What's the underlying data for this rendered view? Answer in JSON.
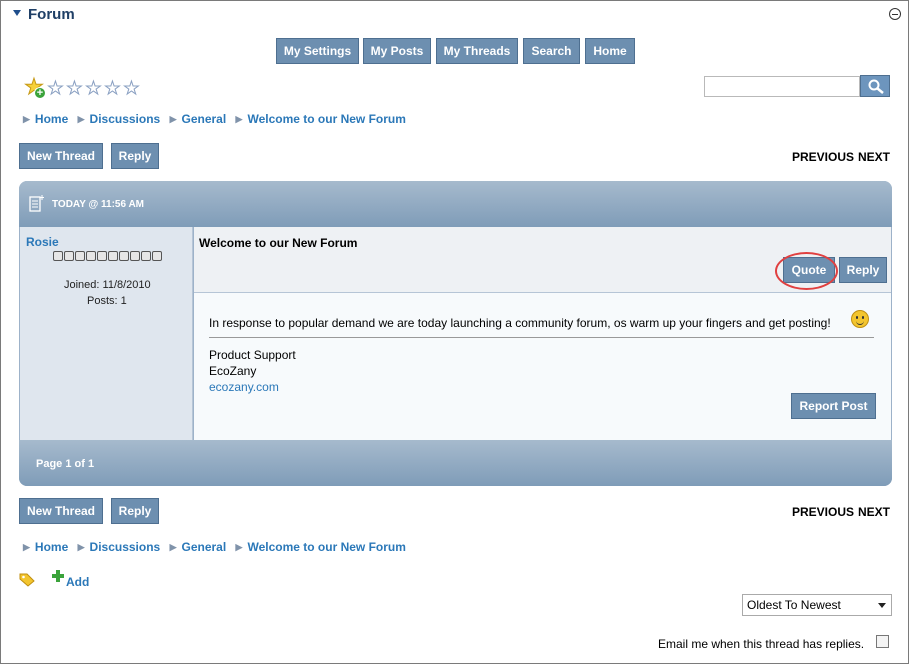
{
  "header": {
    "title": "Forum"
  },
  "nav": {
    "buttons": [
      "My Settings",
      "My Posts",
      "My Threads",
      "Search",
      "Home"
    ]
  },
  "rating": {
    "value": 0,
    "max": 5
  },
  "search": {
    "placeholder": "",
    "value": ""
  },
  "breadcrumb": [
    "Home",
    "Discussions",
    "General",
    "Welcome to our New Forum"
  ],
  "actions": {
    "new_thread": "New Thread",
    "reply": "Reply",
    "previous": "PREVIOUS",
    "next": "NEXT"
  },
  "post": {
    "date": "TODAY @ 11:56 AM",
    "author": "Rosie",
    "joined": "Joined: 11/8/2010",
    "posts": "Posts: 1",
    "title": "Welcome to our New Forum",
    "quote_label": "Quote",
    "reply_label": "Reply",
    "body": "In response to popular demand we are today launching a community forum, os warm up your fingers and get posting!",
    "signature": [
      "Product Support",
      "EcoZany"
    ],
    "signature_link": "ecozany.com",
    "report_label": "Report Post"
  },
  "pager": {
    "label": "Page 1 of 1"
  },
  "tags": {
    "add_label": "Add"
  },
  "sort": {
    "selected": "Oldest To Newest"
  },
  "notify": {
    "label": "Email me when this thread has replies."
  },
  "colors": {
    "accent": "#6d8fb0",
    "link": "#2b78b8",
    "highlight": "#e04040"
  }
}
